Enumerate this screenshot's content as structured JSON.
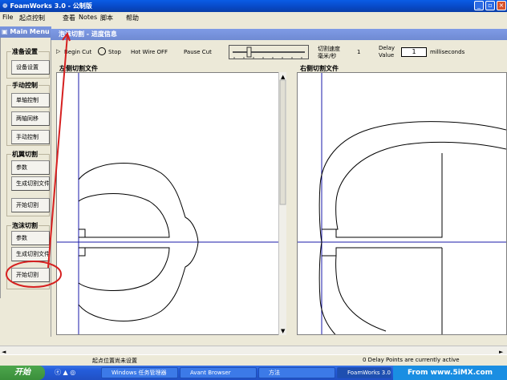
{
  "app": {
    "title": "FoamWorks 3.0 - 公制版"
  },
  "menubar": {
    "items": [
      "File",
      "起点控制",
      "查看",
      "Notes",
      "脚本",
      "帮助"
    ]
  },
  "main_menu": {
    "title": "Main Menu",
    "groups": [
      {
        "label": "准备设置",
        "buttons": [
          "设备设置"
        ]
      },
      {
        "label": "手动控制",
        "buttons": [
          "单轴控制",
          "两轴同移",
          "手动控制"
        ]
      },
      {
        "label": "机翼切割",
        "buttons": [
          "参数",
          "生成切割文件",
          "开始切割"
        ]
      },
      {
        "label": "泡沫切割",
        "buttons": [
          "参数",
          "生成切割文件",
          "开始切割"
        ]
      }
    ]
  },
  "progress_window": {
    "title": "泡沫切割 - 进度信息",
    "begin_cut": "Begin Cut",
    "stop": "Stop",
    "hot_wire": "Hot Wire OFF",
    "pause_cut": "Pause Cut",
    "speed_label_1": "切割速度",
    "speed_label_2": "毫米/秒",
    "speed_value": "1",
    "delay_label_1": "Delay",
    "delay_label_2": "Value",
    "delay_value": "1",
    "milliseconds": "milliseconds",
    "left_label": "左侧切割文件",
    "right_label": "右侧切割文件"
  },
  "status": {
    "left": "起点位置尚未设置",
    "right": "0 Delay Points are currently active"
  },
  "taskbar": {
    "start": "开始",
    "tasks": [
      "Windows 任务管理器",
      "Avant Browser",
      "方法",
      "FoamWorks 3.0 - ..."
    ],
    "watermark": "From www.5iMX.com"
  },
  "colors": {
    "title_blue": "#0a5ce6",
    "highlight_red": "#d62020",
    "axis_blue": "#1a1aa8"
  }
}
